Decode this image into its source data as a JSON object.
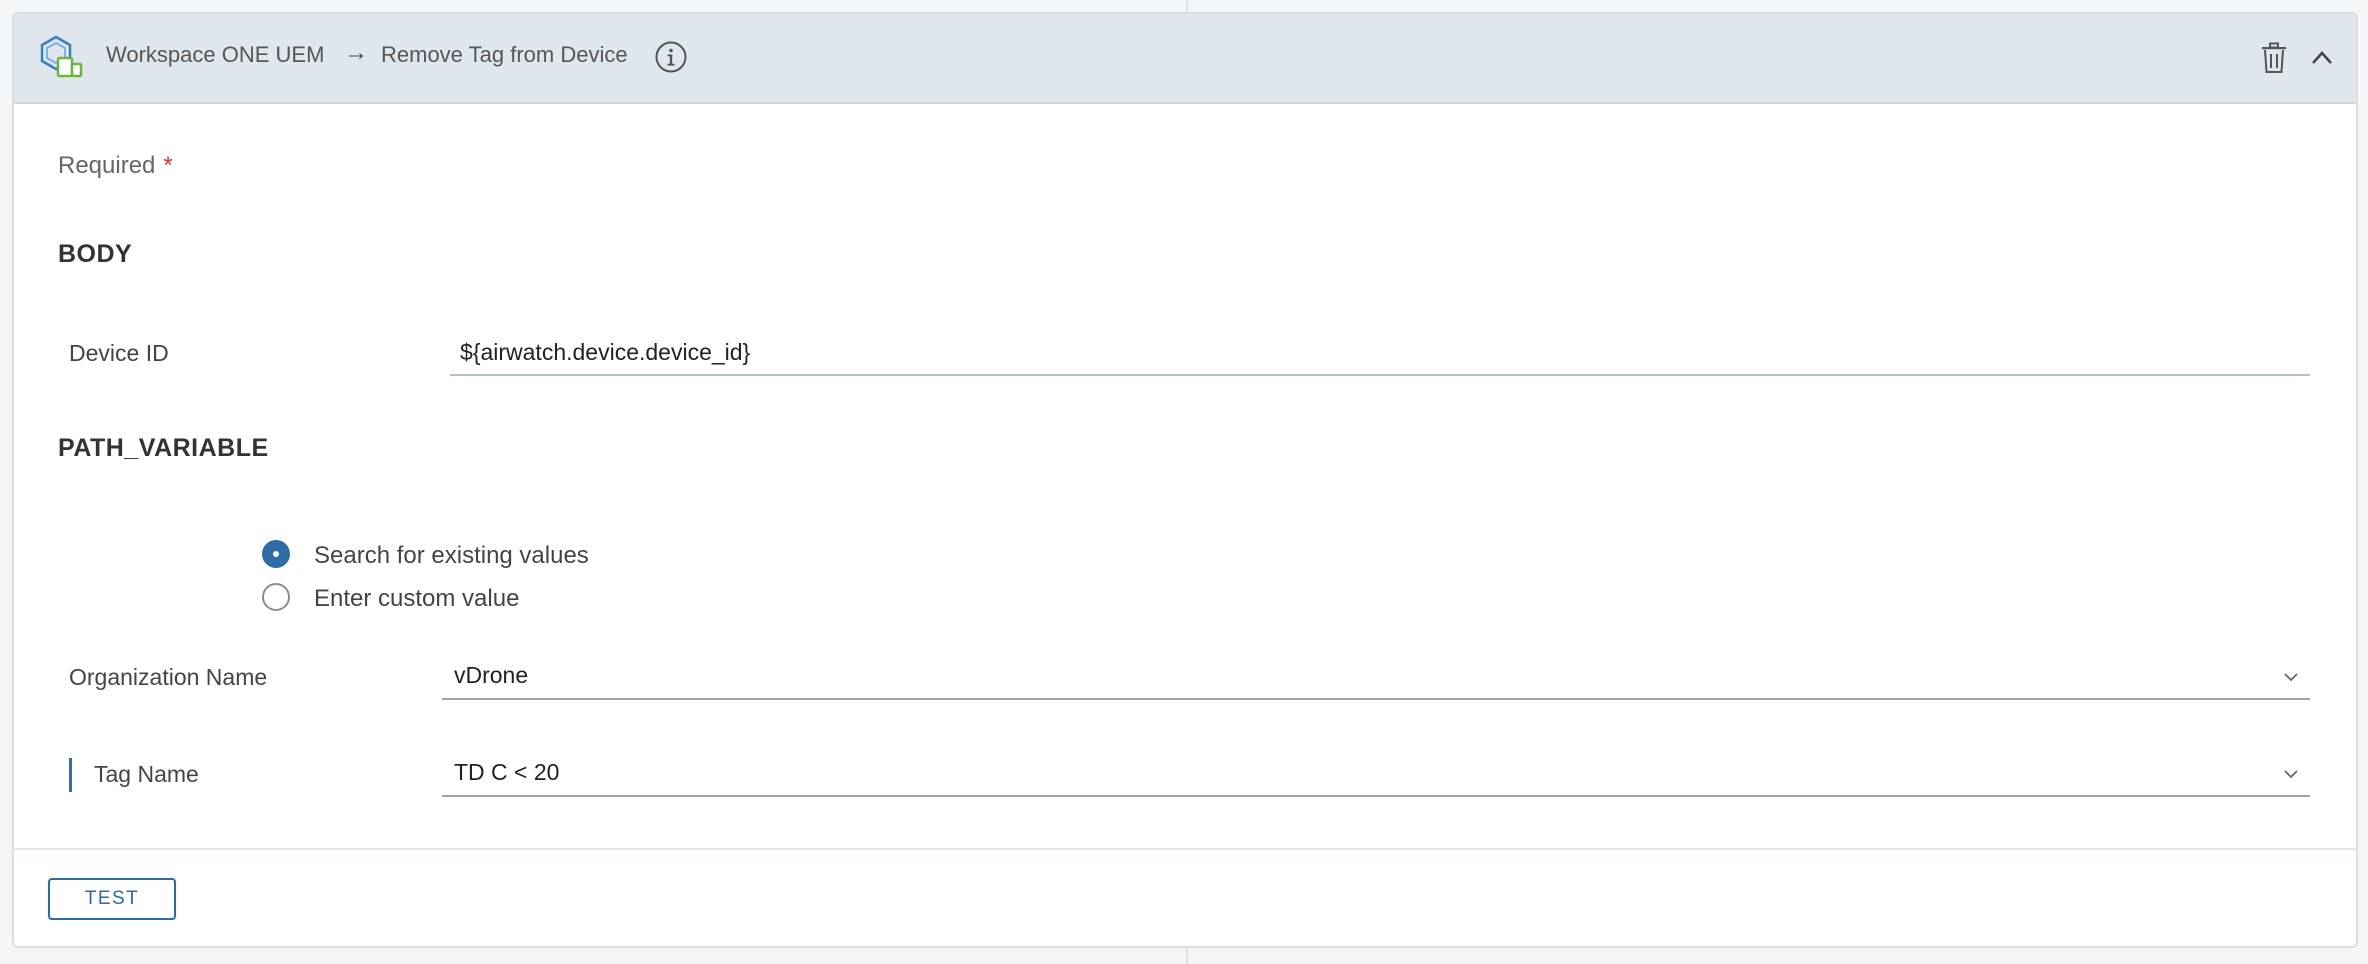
{
  "header": {
    "source": "Workspace ONE UEM",
    "arrow": "→",
    "action": "Remove Tag from Device",
    "icons": [
      "workspace-one-logo",
      "info-icon",
      "trash-icon",
      "chevron-up-icon"
    ]
  },
  "form": {
    "required_label": "Required",
    "required_marker": "*",
    "sections": {
      "body": "BODY",
      "path_variable": "PATH_VARIABLE"
    },
    "device_id": {
      "label": "Device ID",
      "value": "${airwatch.device.device_id}"
    },
    "value_mode": {
      "options": [
        "Search for existing values",
        "Enter custom value"
      ],
      "selected": "Search for existing values"
    },
    "organization_name": {
      "label": "Organization Name",
      "value": "vDrone"
    },
    "tag_name": {
      "label": "Tag Name",
      "value": "TD C < 20"
    }
  },
  "footer": {
    "test_label": "TEST"
  },
  "colors": {
    "header_bg": "#dfe6ec",
    "accent": "#2d6ca5",
    "required": "#d0312d"
  }
}
